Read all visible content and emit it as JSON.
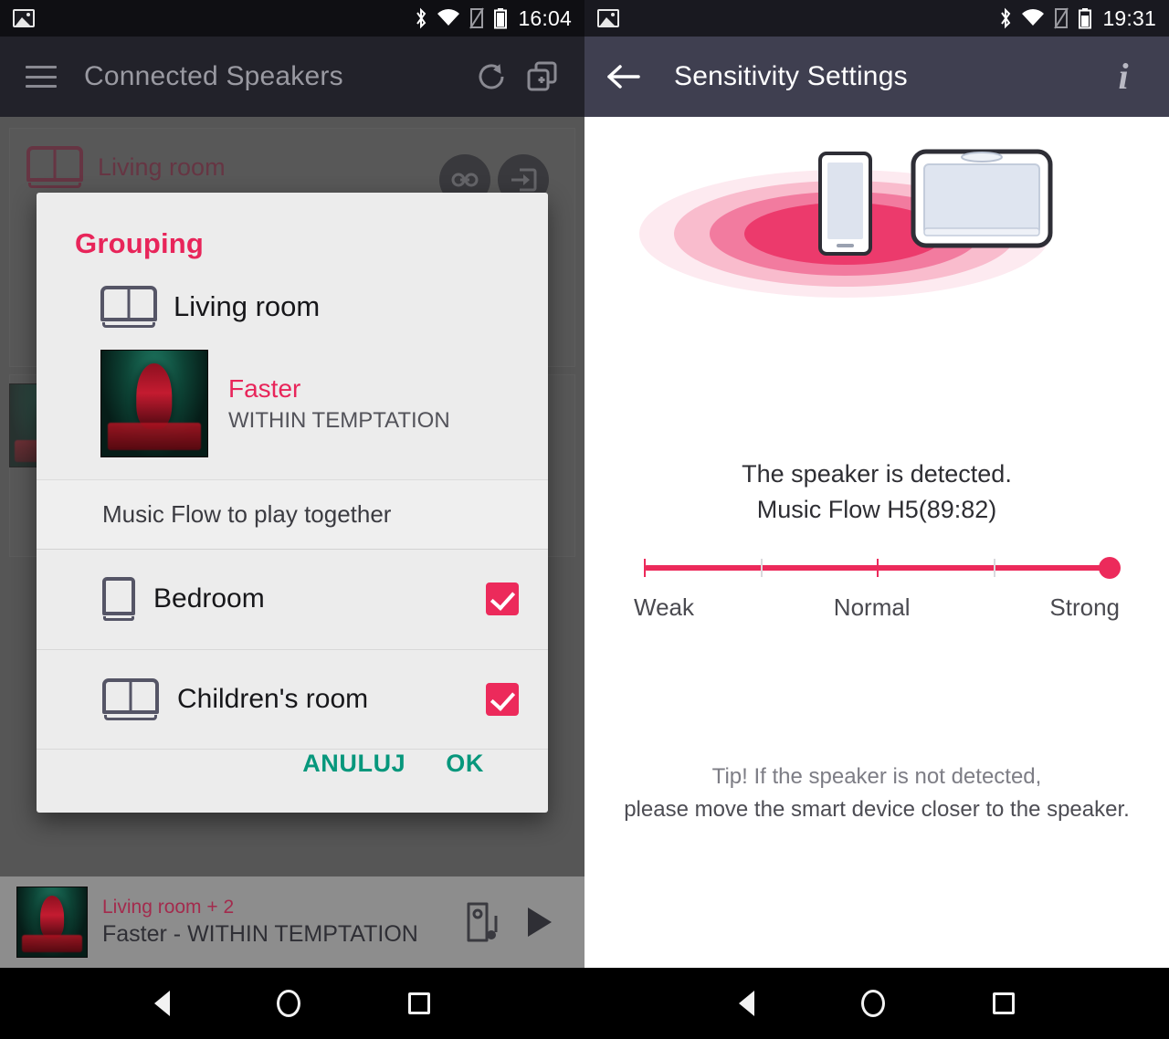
{
  "left": {
    "status": {
      "time": "16:04",
      "icons": [
        "photo-icon",
        "bluetooth-icon",
        "wifi-icon",
        "sim-off-icon",
        "battery-icon"
      ]
    },
    "appbar": {
      "title": "Connected Speakers",
      "menu": "menu-icon",
      "refresh": "refresh-icon",
      "add_group": "add-group-icon"
    },
    "background": {
      "card_room": "Living room",
      "fab_link": "link-icon",
      "fab_connect": "connect-icon"
    },
    "dialog": {
      "title": "Grouping",
      "device": {
        "name": "Living room",
        "icon": "speaker-wide-icon"
      },
      "track": {
        "title": "Faster",
        "artist": "WITHIN TEMPTATION",
        "art": "album-art-the-unforgiving"
      },
      "section_header": "Music Flow to play together",
      "items": [
        {
          "name": "Bedroom",
          "icon": "speaker-tall-icon",
          "checked": true
        },
        {
          "name": "Children's room",
          "icon": "speaker-wide-icon",
          "checked": true
        }
      ],
      "cancel_label": "ANULUJ",
      "ok_label": "OK"
    },
    "nowplaying": {
      "room": "Living room + 2",
      "track": "Faster - WITHIN TEMPTATION",
      "art": "album-art-the-unforgiving",
      "cast_icon": "device-music-icon",
      "play_icon": "play-icon"
    }
  },
  "right": {
    "status": {
      "time": "19:31",
      "icons": [
        "photo-icon",
        "bluetooth-icon",
        "wifi-icon",
        "sim-off-icon",
        "battery-icon"
      ]
    },
    "appbar": {
      "back": "back-arrow-icon",
      "title": "Sensitivity Settings",
      "info": "info-icon"
    },
    "illustration": {
      "phone": "smartphone-icon",
      "speaker": "music-flow-speaker-icon",
      "waves": "sound-wave-rings"
    },
    "status_message": {
      "line1": "The speaker is detected.",
      "line2": "Music Flow H5(89:82)"
    },
    "slider": {
      "value": 4,
      "min": 0,
      "max": 4,
      "ticks": 5,
      "labels": {
        "left": "Weak",
        "center": "Normal",
        "right": "Strong"
      }
    },
    "tip": {
      "line1": "Tip! If the speaker is not detected,",
      "line2": "please move the smart device closer to the speaker."
    }
  },
  "navbar": {
    "back": "nav-back-icon",
    "home": "nav-home-icon",
    "recents": "nav-recents-icon"
  },
  "colors": {
    "accent_pink": "#ec2a5b",
    "dialog_bg": "#ececec",
    "appbar_left": "#22222a",
    "appbar_right": "#3f3f50",
    "action_green": "#07977c"
  }
}
